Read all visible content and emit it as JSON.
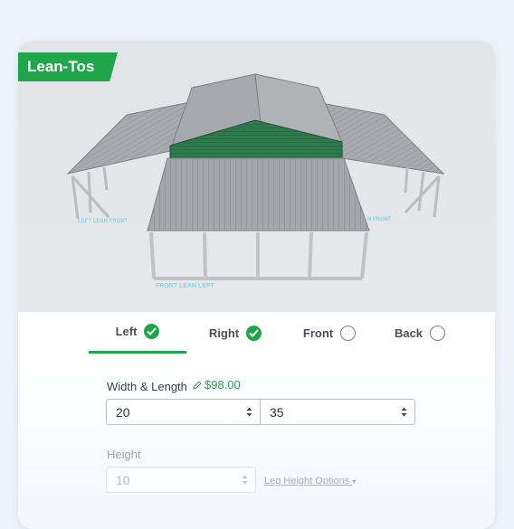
{
  "badge": {
    "label": "Lean-Tos"
  },
  "viewer": {
    "labels": {
      "left_lean_front": "LEFT LEAN FRONT",
      "right_lean_front": "N FRONT",
      "front_lean_left": "FRONT LEAN LEFT"
    }
  },
  "tabs": [
    {
      "label": "Left",
      "state": "checked"
    },
    {
      "label": "Right",
      "state": "checked"
    },
    {
      "label": "Front",
      "state": "unchecked"
    },
    {
      "label": "Back",
      "state": "unchecked"
    }
  ],
  "width_length": {
    "label": "Width & Length",
    "price": "$98.00",
    "width": "20",
    "length": "35"
  },
  "height": {
    "label": "Height",
    "value": "10",
    "options_link": "Leg Height Options"
  },
  "colors": {
    "accent": "#1fa64a",
    "roof": "#9ea2a6",
    "gable": "#2f7a4c"
  }
}
